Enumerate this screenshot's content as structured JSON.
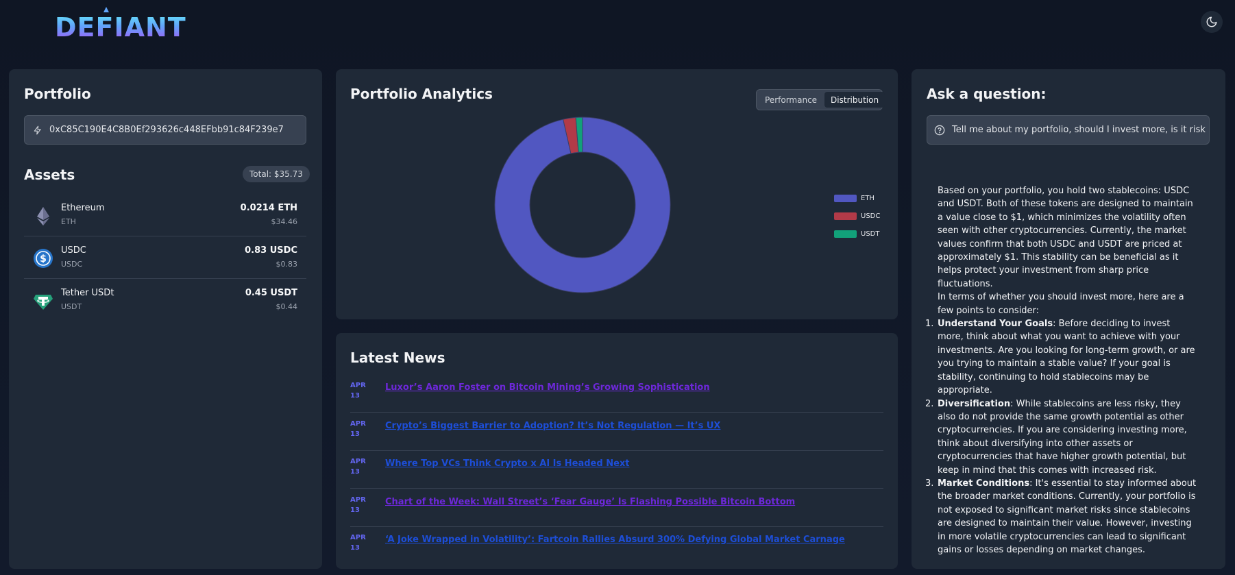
{
  "header": {
    "logo_text": "DEFIANT",
    "theme_icon": "moon-icon"
  },
  "portfolio": {
    "title": "Portfolio",
    "address": "0xC85C190E4C8B0Ef293626c448EFbb91c84F239e7",
    "assets_title": "Assets",
    "total": "Total: $35.73",
    "assets": [
      {
        "name": "Ethereum",
        "symbol": "ETH",
        "amount": "0.0214 ETH",
        "usd": "$34.46",
        "icon": "eth-icon",
        "color": "#8b8fb0"
      },
      {
        "name": "USDC",
        "symbol": "USDC",
        "amount": "0.83 USDC",
        "usd": "$0.83",
        "icon": "usdc-icon",
        "color": "#2775ca"
      },
      {
        "name": "Tether USDt",
        "symbol": "USDT",
        "amount": "0.45 USDT",
        "usd": "$0.44",
        "icon": "usdt-icon",
        "color": "#26a17b"
      }
    ]
  },
  "analytics": {
    "title": "Portfolio Analytics",
    "tabs": [
      {
        "label": "Performance",
        "active": false
      },
      {
        "label": "Distribution",
        "active": true
      }
    ]
  },
  "chart_data": {
    "type": "pie",
    "categories": [
      "ETH",
      "USDC",
      "USDT"
    ],
    "values": [
      34.46,
      0.83,
      0.44
    ],
    "colors": [
      "#5157c1",
      "#b23a48",
      "#12a17a"
    ],
    "donut": true,
    "legend": "right"
  },
  "news": {
    "title": "Latest News",
    "items": [
      {
        "month": "APR",
        "day": "13",
        "title": "Luxor’s Aaron Foster on Bitcoin Mining’s Growing Sophistication",
        "color": "#6d28d9"
      },
      {
        "month": "APR",
        "day": "13",
        "title": "Crypto’s Biggest Barrier to Adoption? It’s Not Regulation — It’s UX",
        "color": "#1d4ed8"
      },
      {
        "month": "APR",
        "day": "13",
        "title": "Where Top VCs Think Crypto x AI Is Headed Next",
        "color": "#1d4ed8"
      },
      {
        "month": "APR",
        "day": "13",
        "title": "Chart of the Week: Wall Street’s ‘Fear Gauge’ Is Flashing Possible Bitcoin Bottom",
        "color": "#6d28d9"
      },
      {
        "month": "APR",
        "day": "13",
        "title": "‘A Joke Wrapped in Volatility’: Fartcoin Rallies Absurd 300% Defying Global Market Carnage",
        "color": "#1d4ed8"
      }
    ]
  },
  "ask": {
    "title": "Ask a question:",
    "question": "Tell me about my portfolio, should I invest more, is it risk",
    "answer_p1": "Based on your portfolio, you hold two stablecoins: USDC and USDT. Both of these tokens are designed to maintain a value close to $1, which minimizes the volatility often seen with other cryptocurrencies. Currently, the market values confirm that both USDC and USDT are priced at approximately $1. This stability can be beneficial as it helps protect your investment from sharp price fluctuations.",
    "answer_p2": "In terms of whether you should invest more, here are a few points to consider:",
    "points": [
      {
        "num": "1.",
        "heading": "Understand Your Goals",
        "text": ": Before deciding to invest more, think about what you want to achieve with your investments. Are you looking for long-term growth, or are you trying to maintain a stable value? If your goal is stability, continuing to hold stablecoins may be appropriate."
      },
      {
        "num": "2.",
        "heading": "Diversification",
        "text": ": While stablecoins are less risky, they also do not provide the same growth potential as other cryptocurrencies. If you are considering investing more, think about diversifying into other assets or cryptocurrencies that have higher growth potential, but keep in mind that this comes with increased risk."
      },
      {
        "num": "3.",
        "heading": "Market Conditions",
        "text": ": It's essential to stay informed about the broader market conditions. Currently, your portfolio is not exposed to significant market risks since stablecoins are designed to maintain their value. However, investing in more volatile cryptocurrencies can lead to significant gains or losses depending on market changes."
      }
    ]
  }
}
